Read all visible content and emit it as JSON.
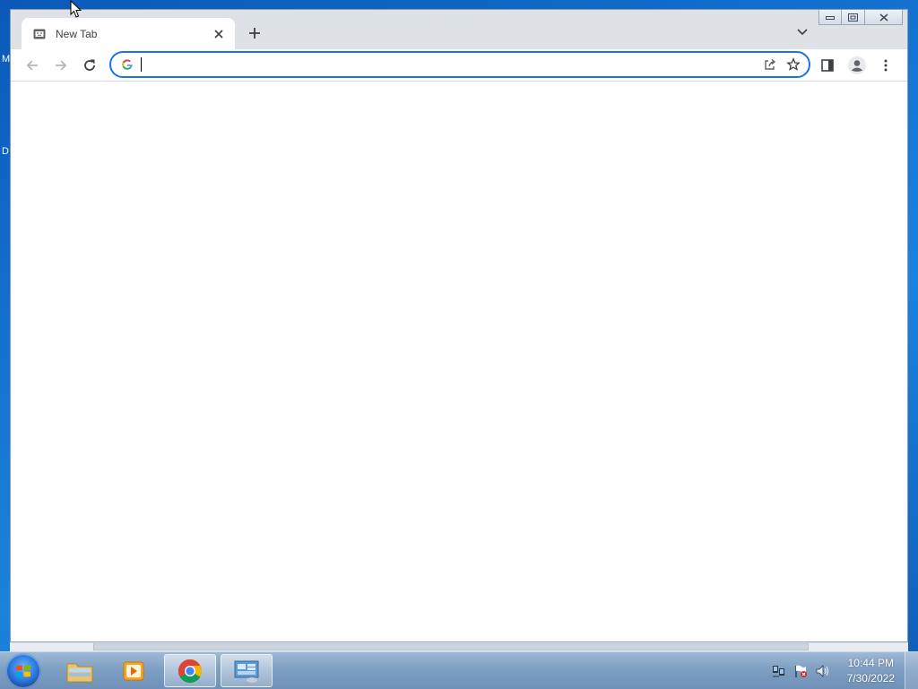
{
  "desktop": {
    "labels": [
      "M",
      "D"
    ]
  },
  "browser": {
    "tab": {
      "title": "New Tab",
      "favicon": "new-tab-icon"
    },
    "omnibox": {
      "value": "",
      "placeholder": ""
    },
    "toolbar_icons": [
      "back-arrow-icon",
      "forward-arrow-icon",
      "reload-icon",
      "share-icon",
      "star-icon",
      "side-panel-icon",
      "profile-icon",
      "more-vert-icon"
    ],
    "colors": {
      "omnibox_focus": "#1a73e8",
      "tabstrip_bg": "#dee1e6"
    }
  },
  "taskbar": {
    "apps": [
      "windows-explorer",
      "media-player",
      "google-chrome",
      "control-panel"
    ],
    "clock": {
      "time": "10:44 PM",
      "date": "7/30/2022"
    }
  }
}
